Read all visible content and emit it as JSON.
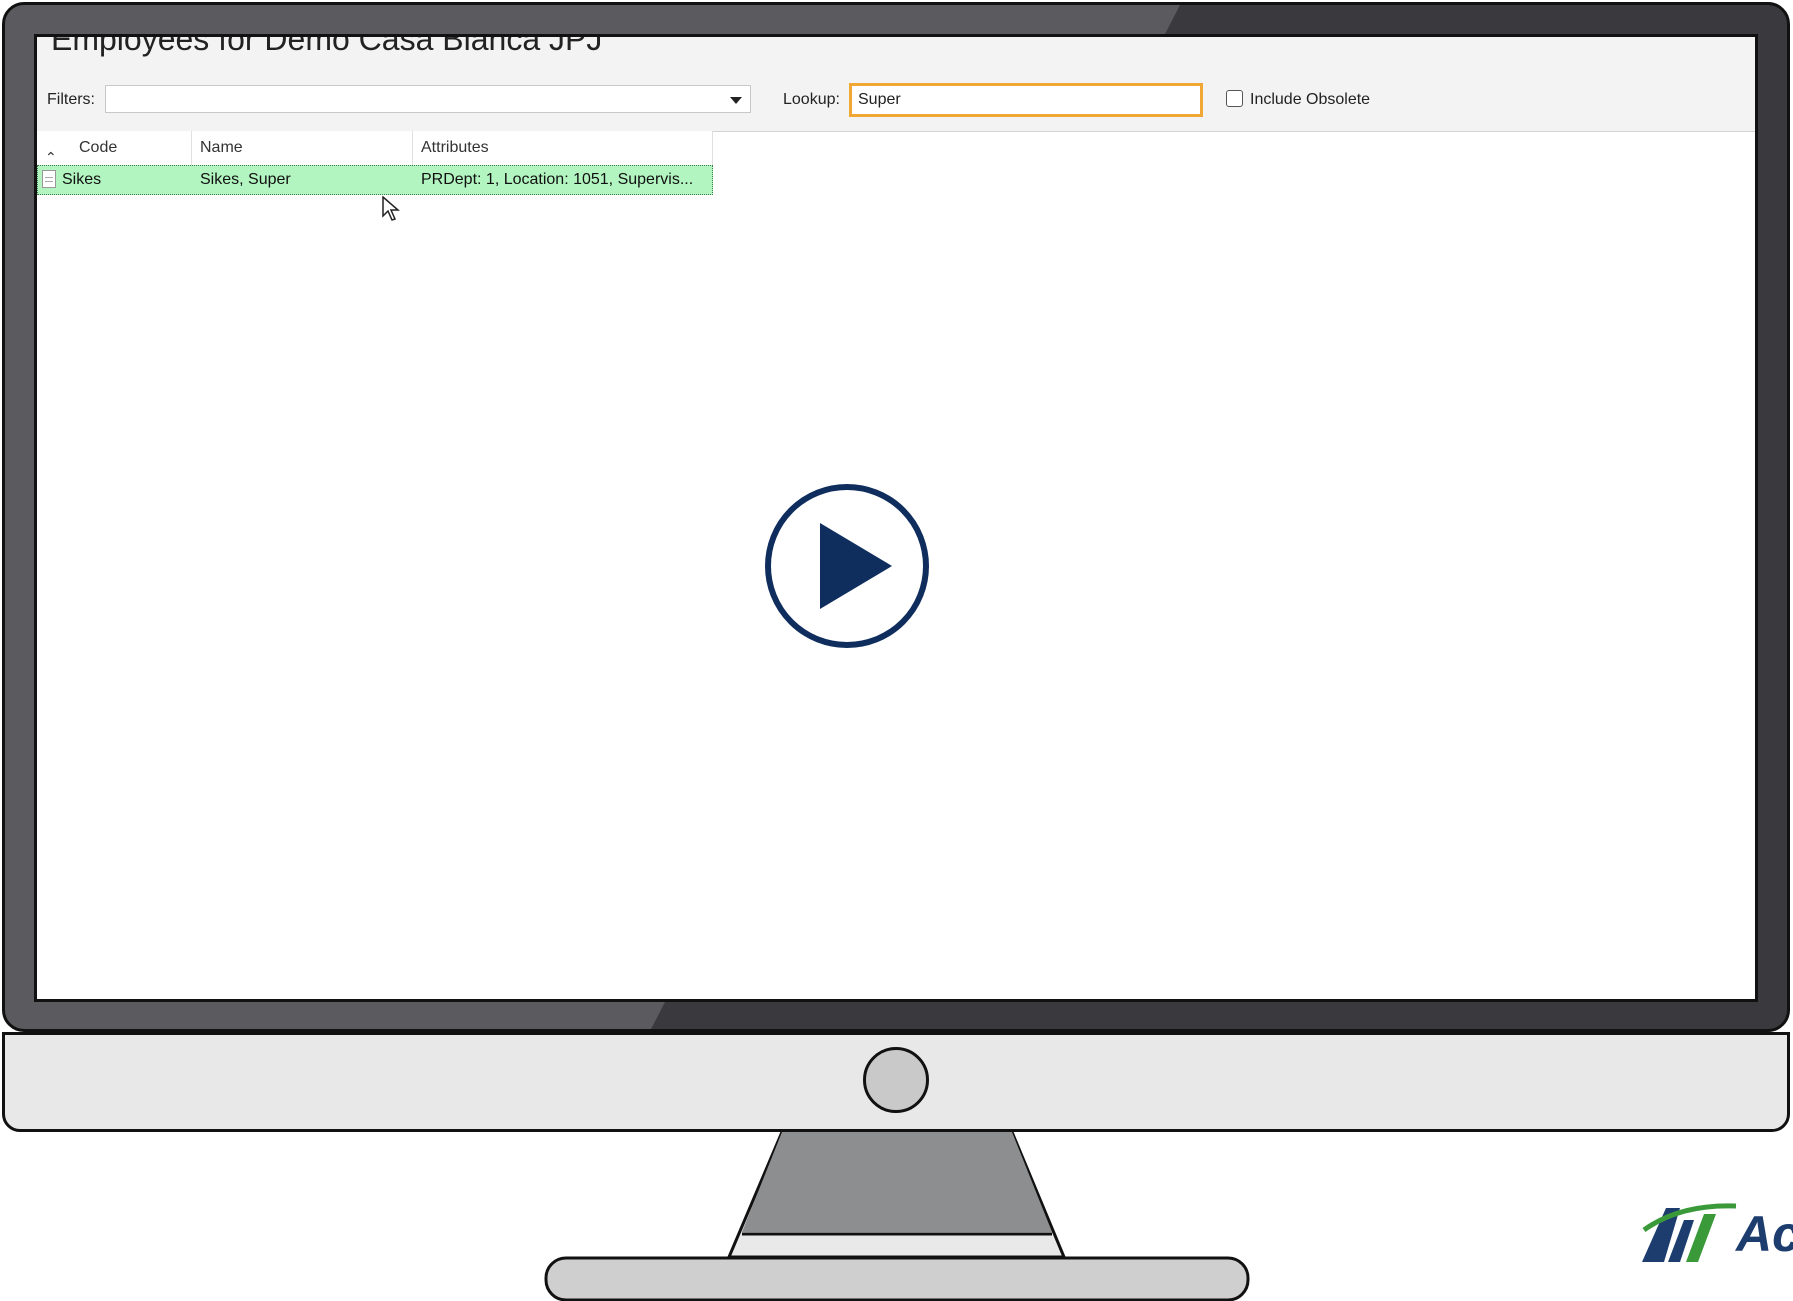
{
  "window": {
    "title": "Employees for Demo Casa Blanca JPJ"
  },
  "toolbar": {
    "filters_label": "Filters:",
    "filters_value": "",
    "lookup_label": "Lookup:",
    "lookup_value": "Super",
    "include_obsolete_label": "Include Obsolete",
    "include_obsolete_checked": false
  },
  "grid": {
    "columns": [
      "Code",
      "Name",
      "Attributes"
    ],
    "rows": [
      {
        "code": "Sikes",
        "name": "Sikes, Super",
        "attributes": "PRDept: 1, Location: 1051, Supervis..."
      }
    ],
    "selected_row_color": "#b2f5c1"
  },
  "video": {
    "play_icon": "play-icon",
    "accent": "#0f2e5e"
  },
  "brand": {
    "logo_text": "Ac",
    "logo_color": "#1c3d6e",
    "logo_green": "#3a9a3a"
  }
}
